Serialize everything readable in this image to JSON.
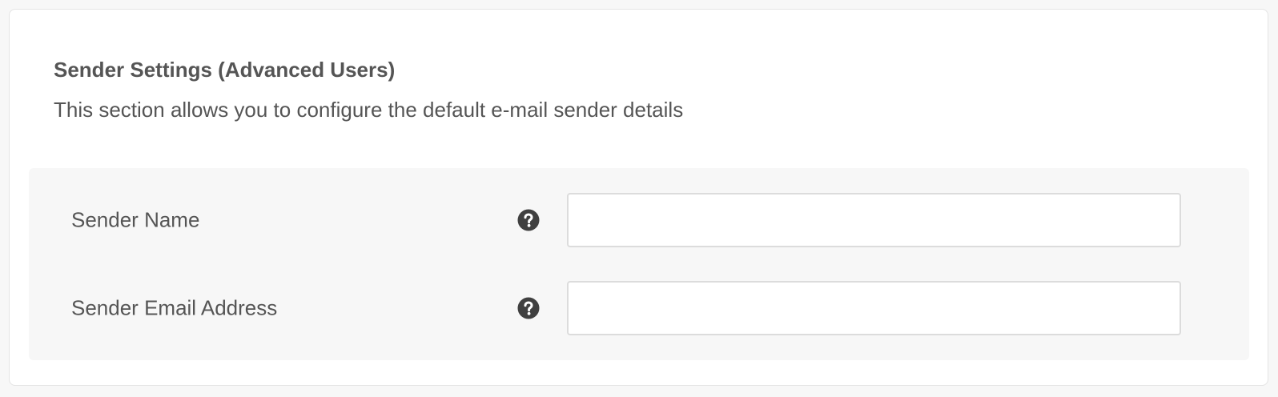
{
  "section": {
    "title": "Sender Settings (Advanced Users)",
    "description": "This section allows you to configure the default e-mail sender details"
  },
  "fields": [
    {
      "label": "Sender Name",
      "help_icon": "question-circle-icon",
      "value": "",
      "placeholder": ""
    },
    {
      "label": "Sender Email Address",
      "help_icon": "question-circle-icon",
      "value": "",
      "placeholder": ""
    }
  ],
  "colors": {
    "page_background": "#f7f7f7",
    "panel_background": "#ffffff",
    "fields_background": "#f7f7f7",
    "text": "#555555",
    "icon": "#404040",
    "input_border": "#dcdcdc"
  }
}
